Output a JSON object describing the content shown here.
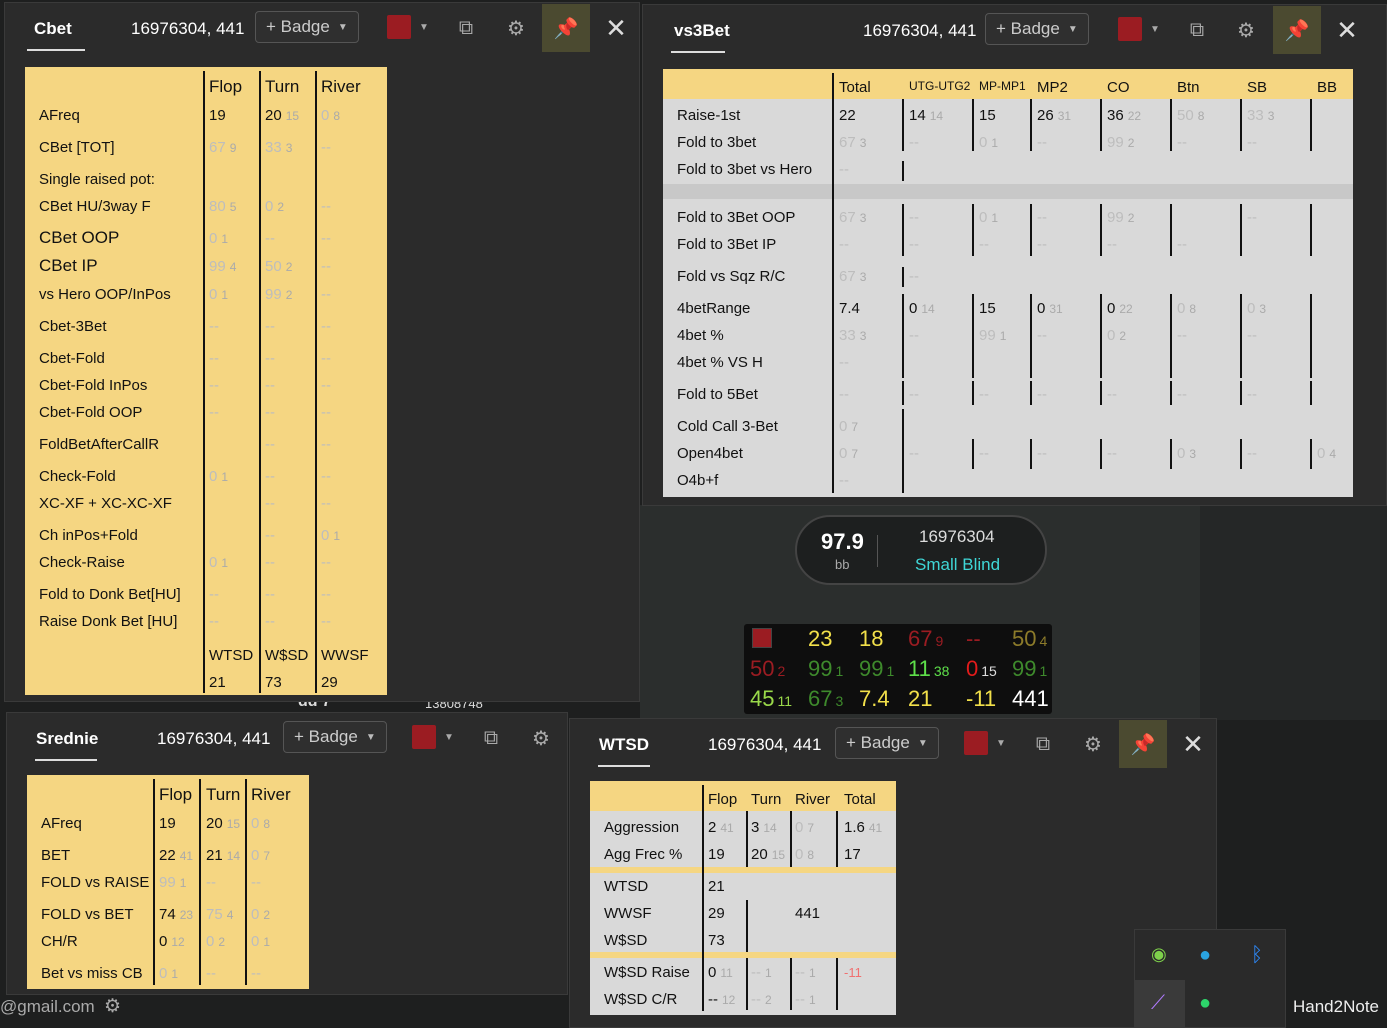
{
  "colors": {
    "sheet_yellow": "#f5d682",
    "sheet_grey": "#d9d9d9",
    "swatch_red": "#9b1c22",
    "pin_bg": "#4b4a30",
    "hud_bg": "#0e0e0e"
  },
  "icons": [
    "copy-icon",
    "gear-icon",
    "pin-icon",
    "close-icon",
    "chevron-down-icon"
  ],
  "cbet": {
    "tab": "Cbet",
    "player_id": "16976304, 441",
    "badge": "+ Badge",
    "headers": [
      "Flop",
      "Turn",
      "River"
    ],
    "rows": [
      [
        "AFreq",
        "19",
        "",
        "20",
        "15",
        "0",
        "8"
      ],
      [
        "CBet [TOT]",
        "67",
        "9",
        "33",
        "3",
        "--",
        ""
      ],
      [
        "Single raised pot:",
        "",
        "",
        "",
        "",
        "",
        ""
      ],
      [
        "CBet HU/3way F",
        "80",
        "5",
        "0",
        "2",
        "--",
        ""
      ],
      [
        "CBet OOP",
        "0",
        "1",
        "--",
        "",
        "--",
        ""
      ],
      [
        "CBet IP",
        "99",
        "4",
        "50",
        "2",
        "--",
        ""
      ],
      [
        "vs Hero OOP/InPos",
        "0",
        "1",
        "99",
        "2",
        "--",
        ""
      ],
      [
        "Cbet-3Bet",
        "--",
        "",
        "--",
        "",
        "--",
        ""
      ],
      [
        "Cbet-Fold",
        "--",
        "",
        "--",
        "",
        "--",
        ""
      ],
      [
        "Cbet-Fold InPos",
        "--",
        "",
        "--",
        "",
        "--",
        ""
      ],
      [
        "Cbet-Fold OOP",
        "--",
        "",
        "--",
        "",
        "--",
        ""
      ],
      [
        "FoldBetAfterCallR",
        "",
        "",
        "--",
        "",
        "--",
        ""
      ],
      [
        "Check-Fold",
        "0",
        "1",
        "--",
        "",
        "--",
        ""
      ],
      [
        "XC-XF + XC-XC-XF",
        "",
        "",
        "--",
        "",
        "--",
        ""
      ],
      [
        "Ch inPos+Fold",
        "",
        "",
        "--",
        "",
        "0",
        "1"
      ],
      [
        "Check-Raise",
        "0",
        "1",
        "--",
        "",
        "--",
        ""
      ],
      [
        "Fold to Donk Bet[HU]",
        "--",
        "",
        "--",
        "",
        "--",
        ""
      ],
      [
        "Raise Donk Bet [HU]",
        "--",
        "",
        "--",
        "",
        "--",
        ""
      ]
    ],
    "footer_labels": [
      "WTSD",
      "W$SD",
      "WWSF"
    ],
    "footer_values": [
      "21",
      "73",
      "29"
    ]
  },
  "vs3bet": {
    "tab": "vs3Bet",
    "player_id": "16976304, 441",
    "badge": "+ Badge",
    "headers": [
      "Total",
      "UTG-UTG2",
      "MP-MP1",
      "MP2",
      "CO",
      "Btn",
      "SB",
      "BB"
    ],
    "labels": [
      "Raise-1st",
      "Fold to 3bet",
      "Fold to 3bet vs Hero",
      "Fold to 3Bet OOP",
      "Fold to 3Bet IP",
      "Fold vs Sqz R/C",
      "4betRange",
      "4bet %",
      "4bet % VS H",
      "Fold to 5Bet",
      "Cold Call 3-Bet",
      "Open4bet",
      "O4b+f"
    ],
    "raise1st": [
      [
        "22",
        ""
      ],
      [
        "14",
        "14"
      ],
      [
        "15",
        ""
      ],
      [
        "26",
        "31"
      ],
      [
        "36",
        "22"
      ],
      [
        "50",
        "8"
      ],
      [
        "33",
        "3"
      ],
      [
        "",
        ""
      ]
    ],
    "fold3bet": [
      [
        "67",
        "3"
      ],
      [
        "--",
        ""
      ],
      [
        "0",
        "1"
      ],
      [
        "--",
        ""
      ],
      [
        "99",
        "2"
      ],
      [
        "--",
        ""
      ],
      [
        "--",
        ""
      ]
    ],
    "fold3bet_hero": "--",
    "fold3bet_oop": [
      [
        "67",
        "3"
      ],
      [
        "--",
        ""
      ],
      [
        "0",
        "1"
      ],
      [
        "--",
        ""
      ],
      [
        "99",
        "2"
      ],
      [
        "",
        ""
      ],
      [
        "--",
        ""
      ]
    ],
    "fold3bet_ip": [
      [
        "--",
        ""
      ],
      [
        "--",
        ""
      ],
      [
        "--",
        ""
      ],
      [
        "--",
        ""
      ],
      [
        "--",
        ""
      ],
      [
        "--",
        ""
      ]
    ],
    "fold_sqz": [
      [
        "67",
        "3"
      ],
      [
        "--",
        ""
      ]
    ],
    "fourbet_range": [
      [
        "7.4",
        ""
      ],
      [
        "0",
        "14"
      ],
      [
        "15",
        ""
      ],
      [
        "0",
        "31"
      ],
      [
        "0",
        "22"
      ],
      [
        "0",
        "8"
      ],
      [
        "0",
        "3"
      ]
    ],
    "fourbet_pct": [
      [
        "33",
        "3"
      ],
      [
        "--",
        ""
      ],
      [
        "99",
        "1"
      ],
      [
        "--",
        ""
      ],
      [
        "0",
        "2"
      ],
      [
        "--",
        ""
      ],
      [
        "--",
        ""
      ]
    ],
    "fourbet_vs_h": "--",
    "fold5bet": [
      "--",
      "--",
      "--",
      "--",
      "--",
      "--",
      "--"
    ],
    "cold_call": [
      "0",
      "7"
    ],
    "open4bet": [
      [
        "0",
        "7"
      ],
      [
        "--",
        ""
      ],
      [
        "--",
        ""
      ],
      [
        "--",
        ""
      ],
      [
        "--",
        ""
      ],
      [
        "0",
        "3"
      ],
      [
        "--",
        ""
      ],
      [
        "0",
        "4"
      ]
    ],
    "o4bf": "--"
  },
  "srednie": {
    "tab": "Srednie",
    "player_id": "16976304, 441",
    "badge": "+ Badge",
    "headers": [
      "Flop",
      "Turn",
      "River"
    ],
    "rows": [
      [
        "AFreq",
        "19",
        "",
        "20",
        "15",
        "0",
        "8"
      ],
      [
        "BET",
        "22",
        "41",
        "21",
        "14",
        "0",
        "7"
      ],
      [
        "FOLD vs RAISE",
        "99",
        "1",
        "--",
        "",
        "--",
        ""
      ],
      [
        "FOLD vs BET",
        "74",
        "23",
        "75",
        "4",
        "0",
        "2"
      ],
      [
        "CH/R",
        "0",
        "12",
        "0",
        "2",
        "0",
        "1"
      ],
      [
        "Bet vs miss CB",
        "0",
        "1",
        "--",
        "",
        "--",
        ""
      ]
    ]
  },
  "wtsd": {
    "tab": "WTSD",
    "player_id": "16976304, 441",
    "badge": "+ Badge",
    "headers": [
      "Flop",
      "Turn",
      "River",
      "Total"
    ],
    "aggression": [
      "Aggression",
      "2",
      "41",
      "3",
      "14",
      "0",
      "7",
      "1.6",
      "41"
    ],
    "agg_freq": [
      "Agg Frec %",
      "19",
      "",
      "20",
      "15",
      "0",
      "8",
      "17",
      ""
    ],
    "wtsd_label": "WTSD",
    "wtsd_val": "21",
    "wwsf_label": "WWSF",
    "wwsf_val": "29",
    "wwsf_extra": "441",
    "wsd_label": "W$SD",
    "wsd_val": "73",
    "wsd_raise": [
      "W$SD Raise",
      "0",
      "11",
      "--",
      "1",
      "--",
      "1",
      "-11"
    ],
    "wsd_cr": [
      "W$SD C/R",
      "--",
      "12",
      "--",
      "2",
      "--",
      "1"
    ]
  },
  "seat": {
    "stack": "97.9",
    "unit": "bb",
    "name": "16976304",
    "position": "Small Blind"
  },
  "hud": {
    "row1": [
      [
        "23",
        ""
      ],
      [
        "18",
        ""
      ],
      [
        "67",
        "9"
      ],
      [
        "--",
        ""
      ],
      [
        "50",
        "4"
      ]
    ],
    "row2": [
      [
        "50",
        "2"
      ],
      [
        "99",
        "1"
      ],
      [
        "99",
        "1"
      ],
      [
        "11",
        "38"
      ],
      [
        "0",
        "15"
      ],
      [
        "99",
        "1"
      ]
    ],
    "row3": [
      [
        "45",
        "11"
      ],
      [
        "67",
        "3"
      ],
      [
        "7.4",
        ""
      ],
      [
        "21",
        ""
      ],
      [
        "-11",
        ""
      ],
      [
        "441",
        ""
      ]
    ]
  },
  "background": {
    "email": "@gmail.com",
    "table_text": "dd 7",
    "table_num": "13808748"
  },
  "tray": {
    "app_label": "Hand2Note"
  }
}
